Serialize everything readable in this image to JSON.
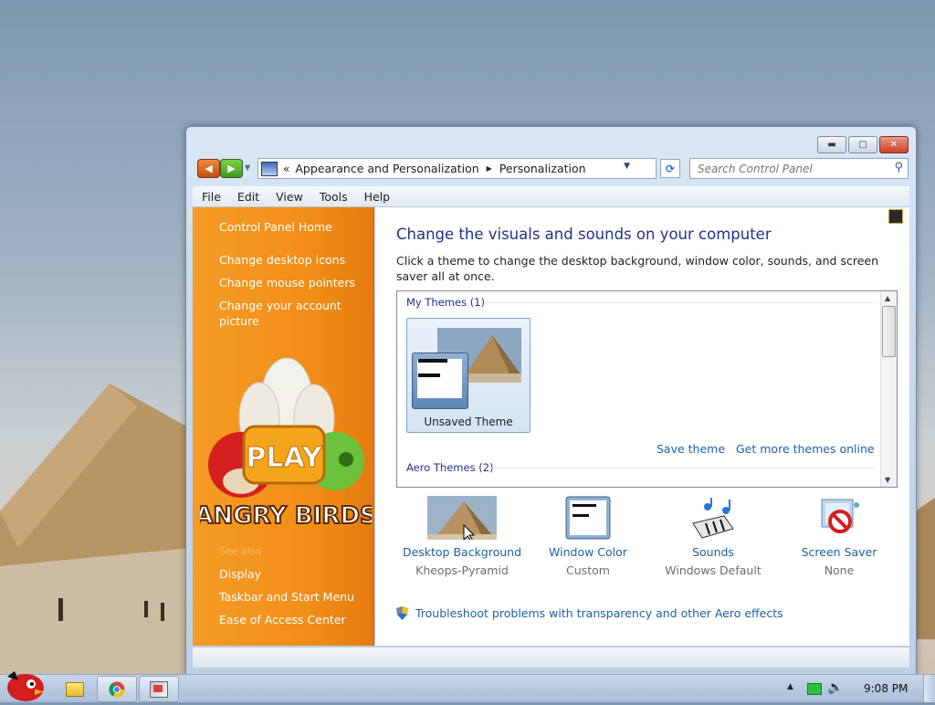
{
  "window": {
    "address": {
      "parent": "Appearance and Personalization",
      "current": "Personalization"
    },
    "search": {
      "placeholder": "Search Control Panel"
    },
    "caption_buttons": {
      "minimize": "▬",
      "maximize": "▢",
      "close": "✕"
    }
  },
  "menu": [
    "File",
    "Edit",
    "View",
    "Tools",
    "Help"
  ],
  "sidebar": {
    "home": "Control Panel Home",
    "tasks": [
      "Change desktop icons",
      "Change mouse pointers",
      "Change your account picture"
    ],
    "art_text": {
      "play": "PLAY",
      "brand": "ANGRY BIRDS"
    },
    "see_also_heading": "See also",
    "see_also": [
      "Display",
      "Taskbar and Start Menu",
      "Ease of Access Center"
    ]
  },
  "main": {
    "title": "Change the visuals and sounds on your computer",
    "description": "Click a theme to change the desktop background, window color, sounds, and screen saver all at once.",
    "themes": {
      "my_themes_header": "My Themes (1)",
      "selected_theme_name": "Unsaved Theme",
      "save_theme": "Save theme",
      "more_themes": "Get more themes online",
      "aero_themes_header": "Aero Themes (2)"
    },
    "settings": [
      {
        "title": "Desktop Background",
        "value": "Kheops-Pyramid",
        "icon": "desktop-background-icon"
      },
      {
        "title": "Window Color",
        "value": "Custom",
        "icon": "window-color-icon"
      },
      {
        "title": "Sounds",
        "value": "Windows Default",
        "icon": "sounds-icon"
      },
      {
        "title": "Screen Saver",
        "value": "None",
        "icon": "screen-saver-icon"
      }
    ],
    "troubleshoot_link": "Troubleshoot problems with transparency and other Aero effects"
  },
  "taskbar": {
    "time": "9:08 PM"
  },
  "colors": {
    "sidebar_orange": "#f08c16",
    "title_blue": "#1e3287",
    "link_blue": "#1f5fa8"
  }
}
